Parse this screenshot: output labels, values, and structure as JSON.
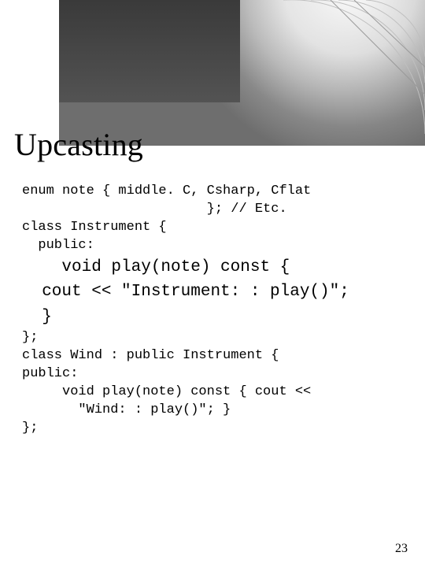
{
  "title": "Upcasting",
  "code": {
    "l1": "enum note { middle. C, Csharp, Cflat",
    "l2": "                       }; // Etc.",
    "l3": "class Instrument {",
    "l4": "  public:",
    "l5": "    void play(note) const {",
    "l6": "  cout << \"Instrument: : play()\";",
    "l7": "  }",
    "l8": "};",
    "l9": "",
    "l10": "class Wind : public Instrument {",
    "l11": "public:",
    "l12": "     void play(note) const { cout <<",
    "l13": "       \"Wind: : play()\"; }",
    "l14": "",
    "l15": "};"
  },
  "page_number": "23"
}
